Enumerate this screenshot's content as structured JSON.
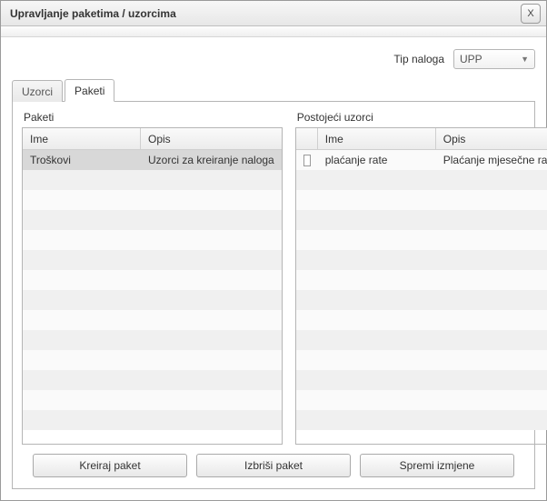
{
  "window": {
    "title": "Upravljanje paketima / uzorcima",
    "close_label": "X"
  },
  "filter": {
    "label": "Tip naloga",
    "value": "UPP"
  },
  "tabs": {
    "uzorci": "Uzorci",
    "paketi": "Paketi",
    "active": "paketi"
  },
  "left": {
    "title": "Paketi",
    "columns": {
      "name": "Ime",
      "desc": "Opis"
    },
    "rows": [
      {
        "name": "Troškovi",
        "desc": "Uzorci za kreiranje naloga",
        "selected": true
      }
    ]
  },
  "right": {
    "title": "Postojeći uzorci",
    "columns": {
      "check": "",
      "name": "Ime",
      "desc": "Opis"
    },
    "rows": [
      {
        "checked": false,
        "name": "plaćanje rate",
        "desc": "Plaćanje mjesečne rate"
      }
    ]
  },
  "buttons": {
    "create": "Kreiraj paket",
    "delete": "Izbriši paket",
    "save": "Spremi izmjene"
  }
}
